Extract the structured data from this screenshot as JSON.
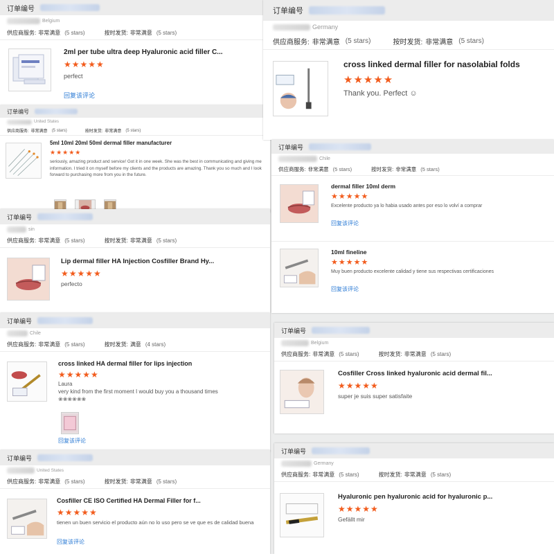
{
  "labels": {
    "order_no": "订单编号",
    "supplier_service": "供应商服务:",
    "on_time_shipping": "按时发货:",
    "reply": "回复该评论"
  },
  "colors": {
    "star": "#f25c1d",
    "link": "#2a7ad4",
    "header_bg": "#ececec"
  },
  "reviews": [
    {
      "country": "Belgium",
      "service_value": "非常满意",
      "service_stars": "(5 stars)",
      "shipping_value": "非常满意",
      "shipping_stars": "(5 stars)",
      "product_title": "2ml per tube ultra deep Hyaluronic acid filler C...",
      "stars": "★★★★★",
      "comment": "perfect",
      "thumb_icon": "product-box-icon"
    },
    {
      "country": "United States",
      "service_value": "非常满意",
      "service_stars": "(5 stars)",
      "shipping_value": "非常满意",
      "shipping_stars": "(5 stars)",
      "product_title": "5ml 10ml 20ml 50ml dermal filler manufacturer",
      "stars": "★★★★★",
      "comment": "seriously, amazing product and service! Got it in one week. She was the best in communicating and giving me information. I tried it on myself before my clients and the products are amazing. Thank you so much and I look forward to purchasing more from you in the future.",
      "thumb_icon": "syringes-icon",
      "photos": [
        "syringe-photo",
        "lips-photo",
        "syringe-photo"
      ]
    },
    {
      "country": "sin",
      "service_value": "非常满意",
      "service_stars": "(5 stars)",
      "shipping_value": "非常满意",
      "shipping_stars": "(5 stars)",
      "product_title": "Lip dermal filler HA Injection Cosfiller Brand Hy...",
      "stars": "★★★★★",
      "comment": "perfecto",
      "thumb_icon": "lips-icon"
    },
    {
      "country": "Chile",
      "service_value": "非常满意",
      "service_stars": "(5 stars)",
      "shipping_value": "满意",
      "shipping_stars": "(4 stars)",
      "product_title": "cross linked HA dermal filler for lips injection",
      "stars": "★★★★★",
      "reviewer": "Laura",
      "comment": "very kind from the first moment I would buy you a thousand times",
      "extra": "❀❀❀❀❀❀",
      "thumb_icon": "lips-syringe-icon",
      "photos": [
        "package-photo"
      ]
    },
    {
      "country": "United States",
      "service_value": "非常满意",
      "service_stars": "(5 stars)",
      "shipping_value": "非常满意",
      "shipping_stars": "(5 stars)",
      "product_title": "Cosfiller CE ISO Certified HA Dermal Filler for f...",
      "stars": "★★★★★",
      "comment": "tienen un buen servicio el producto aún no lo uso pero se ve que es de calidad buena",
      "thumb_icon": "syringe-hand-icon"
    },
    {
      "country": "Germany",
      "service_value": "非常满意",
      "service_stars": "(5 stars)",
      "shipping_value": "非常满意",
      "shipping_stars": "(5 stars)",
      "product_title": "cross linked dermal filler for nasolabial folds",
      "stars": "★★★★★",
      "comment": "Thank you. Perfect ☺",
      "thumb_icon": "face-injection-icon"
    },
    {
      "country": "Chile",
      "service_value": "非常满意",
      "service_stars": "(5 stars)",
      "shipping_value": "非常满意",
      "shipping_stars": "(5 stars)",
      "items": [
        {
          "product_title": "dermal filler 10ml derm",
          "stars": "★★★★★",
          "comment": "Excelente producto ya lo habia usado antes por eso lo volví a comprar",
          "thumb_icon": "lips-icon"
        },
        {
          "product_title": "10ml fineline",
          "stars": "★★★★★",
          "comment": "Muy buen producto excelente calidad y tiene sus respectivas certificaciones",
          "thumb_icon": "syringe-hand-icon"
        }
      ]
    },
    {
      "country": "Belgium",
      "service_value": "非常满意",
      "service_stars": "(5 stars)",
      "shipping_value": "非常满意",
      "shipping_stars": "(5 stars)",
      "product_title": "Cosfiller Cross linked hyaluronic acid dermal fil...",
      "stars": "★★★★★",
      "comment": "super je suis super satisfaite",
      "thumb_icon": "face-model-icon"
    },
    {
      "country": "Germany",
      "service_value": "非常满意",
      "service_stars": "(5 stars)",
      "shipping_value": "非常满意",
      "shipping_stars": "(5 stars)",
      "product_title": "Hyaluronic pen hyaluronic acid for hyaluronic p...",
      "stars": "★★★★★",
      "comment": "Gefällt mir",
      "thumb_icon": "hyaluron-pen-icon"
    }
  ]
}
